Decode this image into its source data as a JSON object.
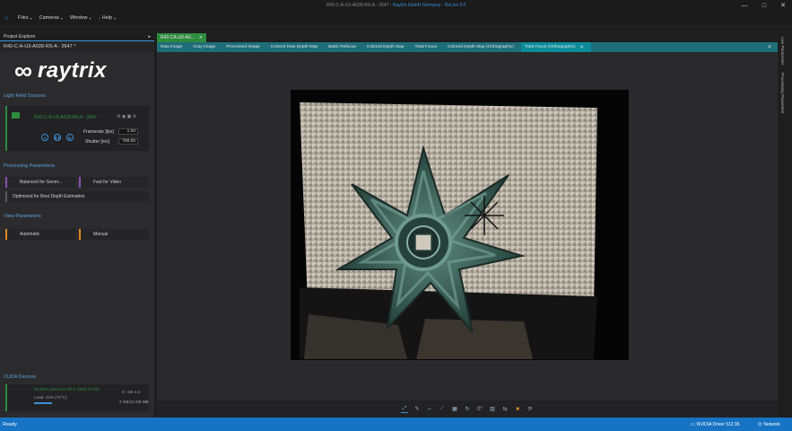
{
  "window": {
    "title_prefix": "R42-C-A-U3-A028-RS-A - 2647 - ",
    "title_app": "Raytrix GmbH Germany - RxLive 5.0",
    "minimize": "—",
    "maximize": "□",
    "close": "✕"
  },
  "menu": {
    "home_icon": "home-icon",
    "items": [
      {
        "label": "Files"
      },
      {
        "label": "Cameras"
      },
      {
        "label": "Window"
      },
      {
        "label": "Help"
      }
    ]
  },
  "project_explorer": {
    "header": "Project Explorer",
    "pin": "▸",
    "camera_name": "R42-C-A-U3-A028-RS-A - 2647 *",
    "logo_text": "raytrix",
    "logo_symbol": "∞"
  },
  "light_field_sources": {
    "title": "Light Field Sources",
    "device": "R42-C-A-U3-A028-RS-A - 2647",
    "framerate_label": "Framerate [fps]",
    "framerate_value": "1.00",
    "shutter_label": "Shutter [ms]",
    "shutter_value": "700.00"
  },
  "processing_parameters": {
    "title": "Processing Parameters",
    "options": [
      {
        "label": "Balanced for Gener..."
      },
      {
        "label": "Fast for Video"
      },
      {
        "label": "Optimized for Best Depth Estimation"
      }
    ]
  },
  "view_parameters": {
    "title": "View Parameters",
    "options": [
      {
        "label": "Automatic"
      },
      {
        "label": "Manual"
      }
    ]
  },
  "cuda_devices": {
    "title": "CUDA Devices",
    "gpu_name": "NVIDIA GeForce RTX 2080 Ti FID",
    "gpu_load": "Load: 22%   (70°C)",
    "gpu_mem": "2 GB/11 GB MB",
    "gpu_index": "0 : sm 4.4",
    "load_fraction": 0.22
  },
  "document": {
    "tab": "R42-CA-U3-A0...",
    "tab_close": "✕"
  },
  "view_tabs": [
    {
      "label": "Raw Image"
    },
    {
      "label": "Gray Image"
    },
    {
      "label": "Processed Image"
    },
    {
      "label": "Colored Raw Depth Map"
    },
    {
      "label": "Basic Refocus"
    },
    {
      "label": "Colored Depth Map"
    },
    {
      "label": "Total Focus"
    },
    {
      "label": "Colored Depth Map (Orthographic)"
    },
    {
      "label": "Total Focus (Orthographic)",
      "active": true
    }
  ],
  "right_rail": {
    "labels": [
      "Live Parameter",
      "Processing Parameter"
    ]
  },
  "toolbar": {
    "zoom_label": "0°",
    "icons": [
      "fit-icon",
      "picker-icon",
      "crop-icon",
      "line-icon",
      "grid-icon",
      "rotate-icon",
      "histogram-icon",
      "mirror-icon",
      "color-icon",
      "refresh-icon"
    ]
  },
  "status_bar": {
    "ready": "Ready",
    "driver": "NVIDIA Driver 512.95",
    "network": "Network"
  },
  "colors": {
    "accent": "#1773c4",
    "tab_teal": "#1e6e78",
    "tab_active": "#0c8c9a",
    "device_green": "#2e8b3e",
    "purple": "#8a4fb0",
    "orange": "#e08a1f"
  }
}
